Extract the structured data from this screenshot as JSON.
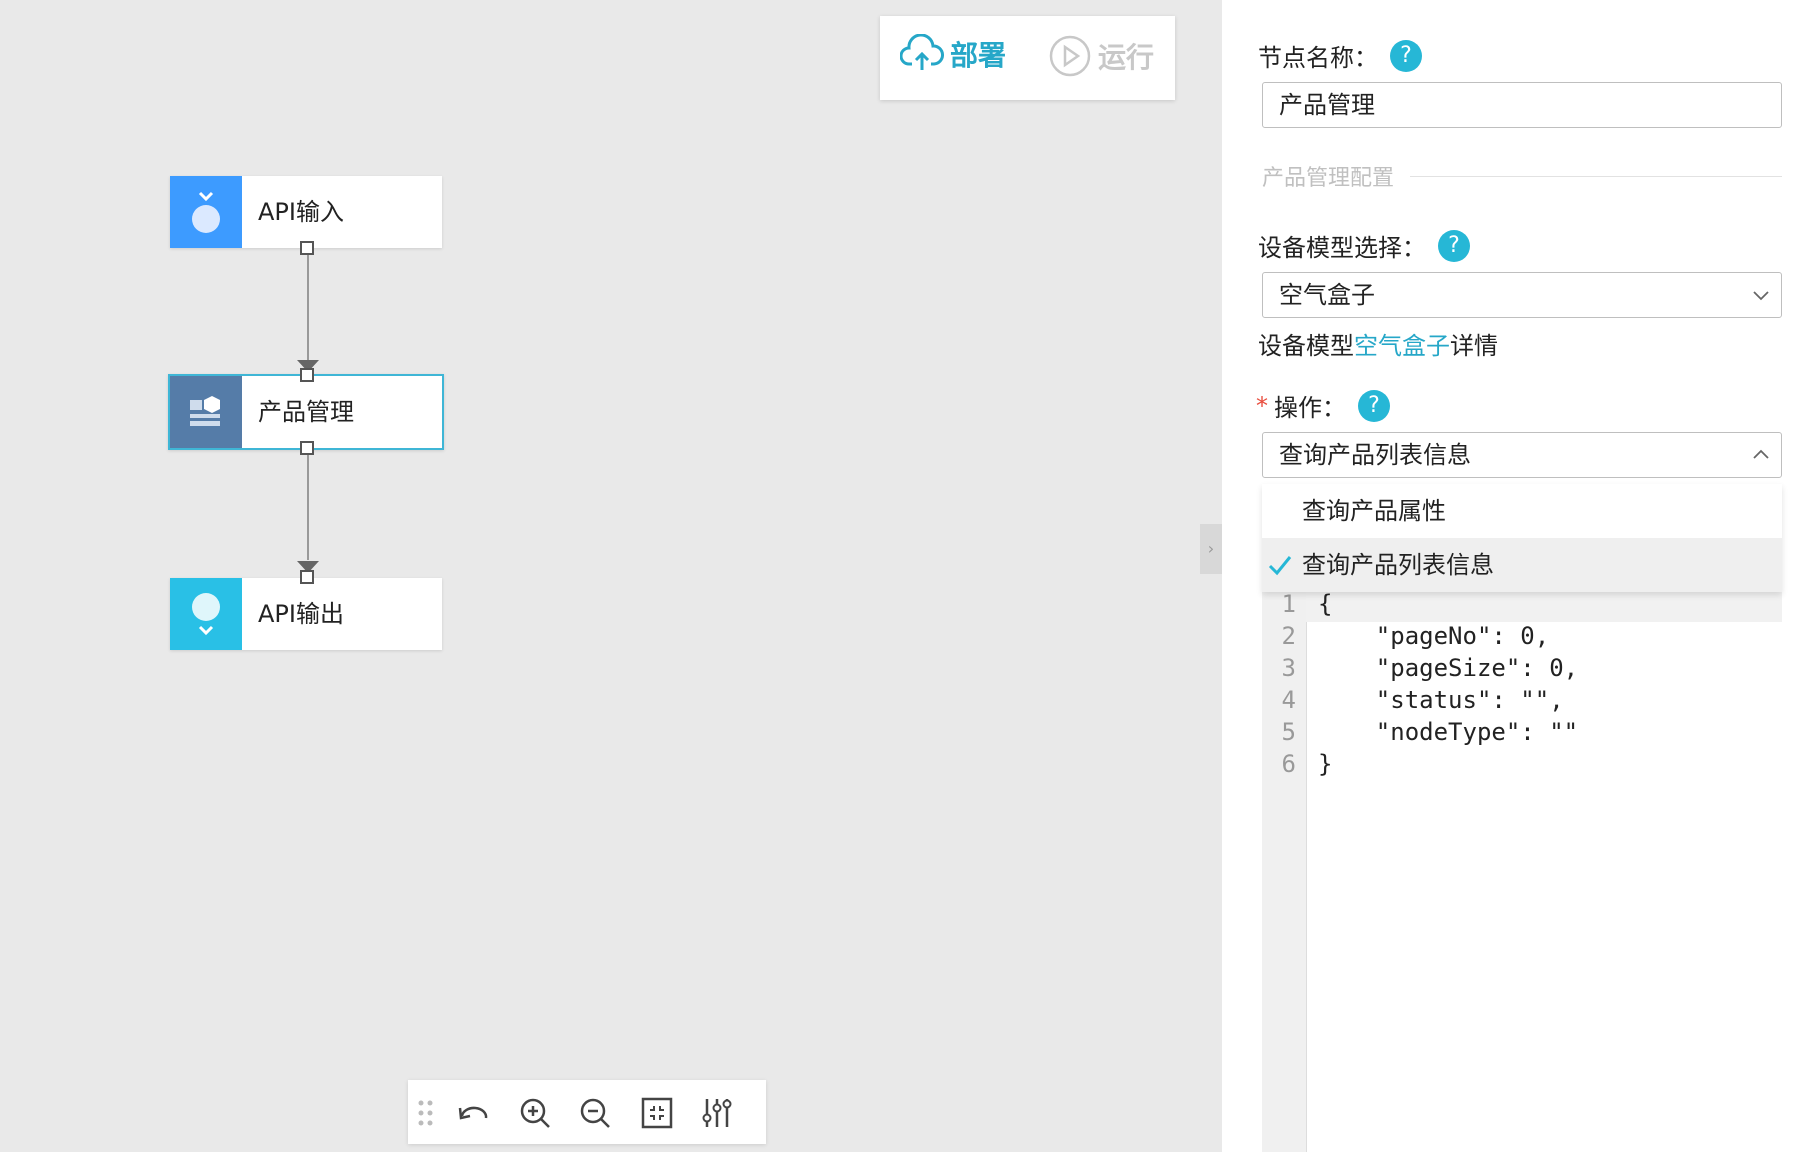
{
  "toolbar": {
    "deploy_label": "部署",
    "run_label": "运行"
  },
  "nodes": [
    {
      "label": "API输入",
      "icon": "api-input-icon",
      "color": "#3d9bff"
    },
    {
      "label": "产品管理",
      "icon": "product-management-icon",
      "color": "#557ca8"
    },
    {
      "label": "API输出",
      "icon": "api-output-icon",
      "color": "#29c0e6"
    }
  ],
  "bottom_toolbar": [
    "drag-handle-icon",
    "undo-icon",
    "zoom-in-icon",
    "zoom-out-icon",
    "fit-screen-icon",
    "settings-sliders-icon"
  ],
  "panel": {
    "node_name_label": "节点名称：",
    "node_name_value": "产品管理",
    "section_title": "产品管理配置",
    "device_model_label": "设备模型选择：",
    "device_model_value": "空气盒子",
    "device_model_link_prefix": "设备模型",
    "device_model_link": "空气盒子",
    "device_model_link_suffix": "详情",
    "operation_required": "*",
    "operation_label": "操作：",
    "operation_value": "查询产品列表信息",
    "operation_options": [
      "查询产品属性",
      "查询产品列表信息"
    ],
    "help_symbol": "?"
  },
  "editor": {
    "line_numbers": [
      "1",
      "2",
      "3",
      "4",
      "5",
      "6"
    ],
    "lines": [
      "{",
      "    \"pageNo\": 0,",
      "    \"pageSize\": 0,",
      "    \"status\": \"\",",
      "    \"nodeType\": \"\"",
      "}"
    ]
  },
  "colors": {
    "accent": "#26b7d6",
    "link": "#26a7c8",
    "required": "#e84c3d"
  }
}
